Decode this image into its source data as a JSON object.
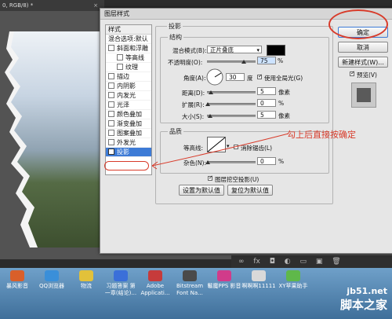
{
  "document_tab": {
    "title": "0, RGB/8) *"
  },
  "dialog": {
    "title": "图层样式",
    "style_list": {
      "header": "样式",
      "items": [
        {
          "label": "混合选项:默认",
          "checkbox": false,
          "indent": false,
          "selected": false
        },
        {
          "label": "斜面和浮雕",
          "checkbox": true,
          "indent": false,
          "selected": false
        },
        {
          "label": "等高线",
          "checkbox": true,
          "indent": true,
          "selected": false
        },
        {
          "label": "纹理",
          "checkbox": true,
          "indent": true,
          "selected": false
        },
        {
          "label": "描边",
          "checkbox": true,
          "indent": false,
          "selected": false
        },
        {
          "label": "内阴影",
          "checkbox": true,
          "indent": false,
          "selected": false
        },
        {
          "label": "内发光",
          "checkbox": true,
          "indent": false,
          "selected": false
        },
        {
          "label": "光泽",
          "checkbox": true,
          "indent": false,
          "selected": false
        },
        {
          "label": "颜色叠加",
          "checkbox": true,
          "indent": false,
          "selected": false
        },
        {
          "label": "渐变叠加",
          "checkbox": true,
          "indent": false,
          "selected": false
        },
        {
          "label": "图案叠加",
          "checkbox": true,
          "indent": false,
          "selected": false
        },
        {
          "label": "外发光",
          "checkbox": true,
          "indent": false,
          "selected": false
        },
        {
          "label": "投影",
          "checkbox": true,
          "indent": false,
          "selected": true
        }
      ]
    },
    "shadow": {
      "section_title": "投影",
      "structure_title": "结构",
      "blend_mode_label": "混合模式(B):",
      "blend_mode_value": "正片叠底",
      "shadow_color": "#000000",
      "opacity_label": "不透明度(O):",
      "opacity_value": "75",
      "angle_label": "角度(A):",
      "angle_value": "30",
      "angle_unit": "度",
      "global_light_label": "使用全局光(G)",
      "distance_label": "距离(D):",
      "distance_value": "5",
      "spread_label": "扩展(R):",
      "spread_value": "0",
      "size_label": "大小(S):",
      "size_value": "5",
      "percent": "%",
      "px_unit": "像素",
      "quality_title": "品质",
      "contour_label": "等高线:",
      "antialias_label": "消除锯齿(L)",
      "noise_label": "杂色(N):",
      "noise_value": "0",
      "knockout_label": "图层挖空投影(U)",
      "make_default": "设置为默认值",
      "reset_default": "复位为默认值"
    },
    "buttons": {
      "ok": "确定",
      "cancel": "取消",
      "new_style": "新建样式(W)...",
      "preview": "预览(V)"
    }
  },
  "annotation": {
    "text": "勾上后直接按确定",
    "color": "#d83b2a"
  },
  "layer_bar_icons": [
    "link-icon",
    "fx-icon",
    "mask-icon",
    "adjustment-icon",
    "group-icon",
    "new-layer-icon",
    "trash-icon"
  ],
  "taskbar": {
    "items": [
      {
        "label": "暴风影音",
        "color": "#d95f2a"
      },
      {
        "label": "QQ浏览器",
        "color": "#3a8fd9"
      },
      {
        "label": "物流",
        "color": "#e2c13a"
      },
      {
        "label": "习题答案 第一章(结论)...",
        "color": "#3a6fd9"
      },
      {
        "label": "Adobe Applicati...",
        "color": "#c63b3b"
      },
      {
        "label": "Bitstream Font Na...",
        "color": "#4a4a4a"
      },
      {
        "label": "鬈魔PPS 影音",
        "color": "#d13b8a"
      },
      {
        "label": "啊啊啊11111",
        "color": "#d9d9d9"
      },
      {
        "label": "XY苹果助手",
        "color": "#5fb84a"
      }
    ]
  },
  "watermark": {
    "site": "jb51.net",
    "brand": "脚本之家"
  }
}
